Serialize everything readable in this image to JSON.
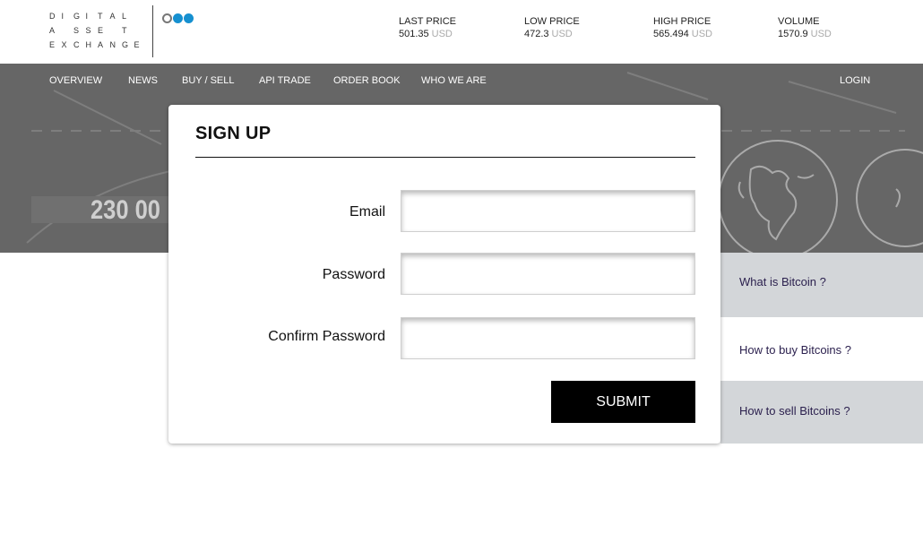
{
  "logo": {
    "lines": [
      "DIGITAL",
      "ASSET",
      "EXCHANGE"
    ],
    "dots": [
      "outline",
      "blue",
      "blue"
    ],
    "accent_color": "#1690d0"
  },
  "ticker": [
    {
      "label": "LAST PRICE",
      "value": "501.35",
      "unit": "USD"
    },
    {
      "label": "LOW PRICE",
      "value": "472.3",
      "unit": "USD"
    },
    {
      "label": "HIGH PRICE",
      "value": "565.494",
      "unit": "USD"
    },
    {
      "label": "VOLUME",
      "value": "1570.9",
      "unit": "USD"
    }
  ],
  "nav": {
    "items": [
      "OVERVIEW",
      "NEWS",
      "BUY / SELL",
      "API TRADE",
      "ORDER BOOK",
      "WHO WE ARE"
    ],
    "login": "LOGIN"
  },
  "hero": {
    "number": "230 00",
    "background_color": "#666666",
    "globe_icon": "globe-icon"
  },
  "faq": [
    "What is Bitcoin ?",
    "How to buy Bitcoins ?",
    "How to sell Bitcoins ?"
  ],
  "signup": {
    "title": "SIGN UP",
    "fields": [
      {
        "label": "Email",
        "value": "",
        "placeholder": ""
      },
      {
        "label": "Password",
        "value": "",
        "placeholder": ""
      },
      {
        "label": "Confirm Password",
        "value": "",
        "placeholder": ""
      }
    ],
    "submit": "SUBMIT"
  }
}
